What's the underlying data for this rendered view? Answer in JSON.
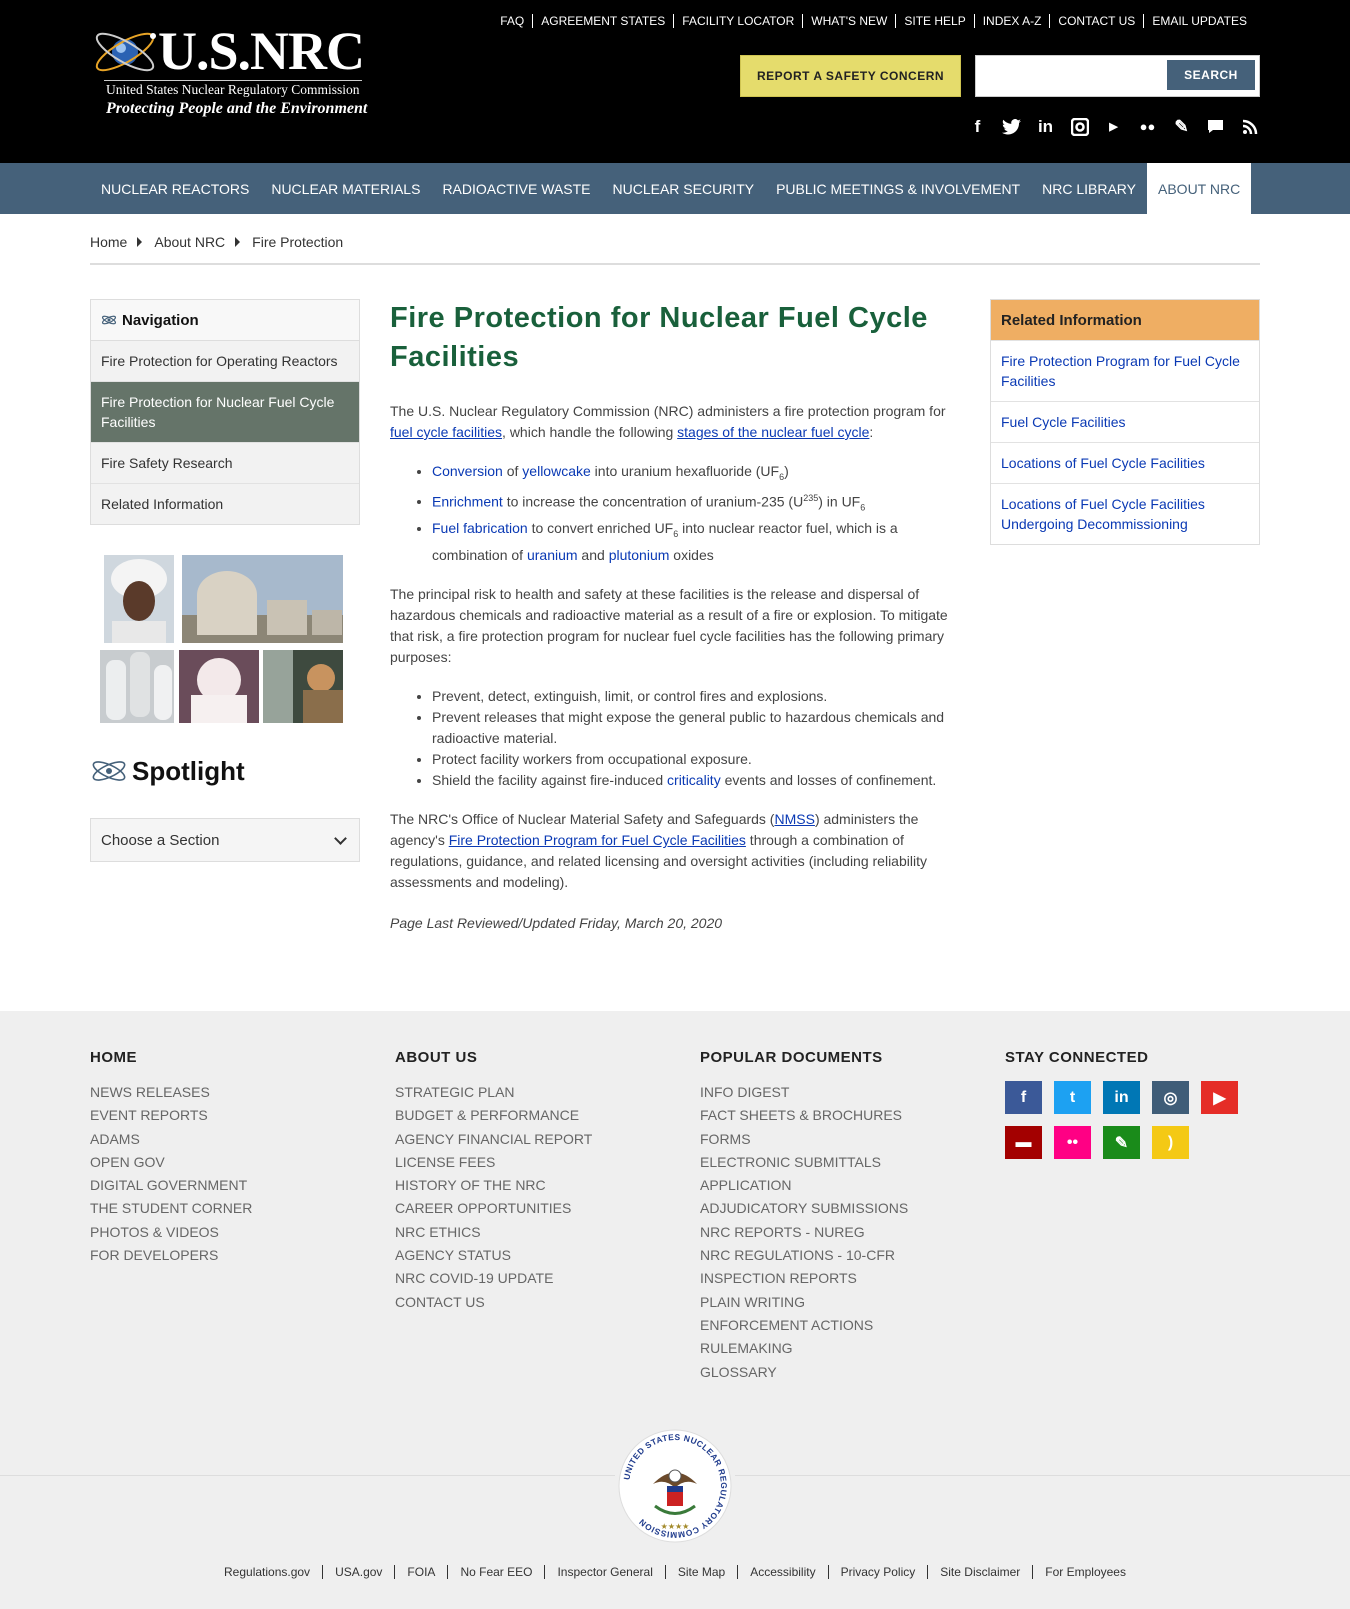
{
  "header": {
    "logo_title": "U.S.NRC",
    "logo_subtitle": "United States Nuclear Regulatory Commission",
    "logo_tagline": "Protecting People and the Environment",
    "utility_links": [
      "FAQ",
      "AGREEMENT STATES",
      "FACILITY LOCATOR",
      "WHAT'S NEW",
      "SITE HELP",
      "INDEX A-Z",
      "CONTACT US",
      "EMAIL UPDATES"
    ],
    "report_button": "REPORT A SAFETY CONCERN",
    "search_placeholder": "",
    "search_button": "SEARCH",
    "social_icons": [
      "facebook-icon",
      "twitter-icon",
      "linkedin-icon",
      "instagram-icon",
      "youtube-icon",
      "flickr-icon",
      "blog-icon",
      "comment-icon",
      "rss-icon"
    ]
  },
  "mainnav": {
    "items": [
      "NUCLEAR REACTORS",
      "NUCLEAR MATERIALS",
      "RADIOACTIVE WASTE",
      "NUCLEAR SECURITY",
      "PUBLIC MEETINGS & INVOLVEMENT",
      "NRC LIBRARY",
      "ABOUT NRC"
    ],
    "active": "ABOUT NRC"
  },
  "breadcrumb": [
    "Home",
    "About NRC",
    "Fire Protection"
  ],
  "leftnav": {
    "title": "Navigation",
    "items": [
      "Fire Protection for Operating Reactors",
      "Fire Protection for Nuclear Fuel Cycle Facilities",
      "Fire Safety Research",
      "Related Information"
    ]
  },
  "spotlight": {
    "title": "Spotlight",
    "select_value": "Choose a Section"
  },
  "content": {
    "title": "Fire Protection for Nuclear Fuel Cycle Facilities",
    "intro_1": "The U.S. Nuclear Regulatory Commission (NRC) administers a fire protection program for ",
    "link_fuel_cycle_facilities": "fuel cycle facilities",
    "intro_2": ", which handle the following ",
    "link_stages": "stages of the nuclear fuel cycle",
    "intro_3": ":",
    "b1": {
      "l1": "Conversion",
      "t1": " of ",
      "l2": "yellowcake",
      "t2": " into uranium hexafluoride (UF",
      "s1": "6",
      "t3": ")"
    },
    "b2": {
      "l1": "Enrichment",
      "t1": " to increase the concentration of uranium-235 (U",
      "sup": "235",
      "t2": ") in UF",
      "s1": "6"
    },
    "b3": {
      "l1": "Fuel fabrication",
      "t1": " to convert enriched UF",
      "s1": "6",
      "t2": " into nuclear reactor fuel, which is a combination of ",
      "l2": "uranium",
      "t3": " and ",
      "l3": "plutonium",
      "t4": " oxides"
    },
    "para2": "The principal risk to health and safety at these facilities is the release and dispersal of hazardous chemicals and radioactive material as a result of a fire or explosion. To mitigate that risk, a fire protection program for nuclear fuel cycle facilities has the following primary purposes:",
    "purposes": [
      "Prevent, detect, extinguish, limit, or control fires and explosions.",
      "Prevent releases that might expose the general public to hazardous chemicals and radioactive material.",
      "Protect facility workers from occupational exposure."
    ],
    "p4_text": "Shield the facility against fire-induced ",
    "p4_link": "criticality",
    "p4_end": " events and losses of confinement.",
    "para3_1": "The NRC's Office of Nuclear Material Safety and Safeguards (",
    "para3_link1": "NMSS",
    "para3_2": ") administers the agency's ",
    "para3_link2": "Fire Protection Program for Fuel Cycle Facilities",
    "para3_3": " through a combination of regulations, guidance, and related licensing and oversight activities (including reliability assessments and modeling).",
    "reviewed": "Page Last Reviewed/Updated Friday, March 20, 2020"
  },
  "related": {
    "title": "Related Information",
    "items": [
      "Fire Protection Program for Fuel Cycle Facilities",
      "Fuel Cycle Facilities",
      "Locations of Fuel Cycle Facilities",
      "Locations of Fuel Cycle Facilities Undergoing Decommissioning"
    ]
  },
  "footer": {
    "col1": {
      "title": "HOME",
      "links": [
        "NEWS RELEASES",
        "EVENT REPORTS",
        "ADAMS",
        "OPEN GOV",
        "DIGITAL GOVERNMENT",
        "THE STUDENT CORNER",
        "PHOTOS & VIDEOS",
        "FOR DEVELOPERS"
      ]
    },
    "col2": {
      "title": "ABOUT US",
      "links": [
        "STRATEGIC PLAN",
        "BUDGET & PERFORMANCE",
        "AGENCY FINANCIAL REPORT",
        "LICENSE FEES",
        "HISTORY OF THE NRC",
        "CAREER OPPORTUNITIES",
        "NRC ETHICS",
        "AGENCY STATUS",
        "NRC COVID-19 UPDATE",
        "CONTACT US"
      ]
    },
    "col3": {
      "title": "POPULAR DOCUMENTS",
      "links": [
        "INFO DIGEST",
        "FACT SHEETS & BROCHURES",
        "FORMS",
        "ELECTRONIC SUBMITTALS",
        "APPLICATION",
        "ADJUDICATORY SUBMISSIONS",
        "NRC REPORTS - NUREG",
        "NRC REGULATIONS - 10-CFR",
        "INSPECTION REPORTS",
        "PLAIN WRITING",
        "ENFORCEMENT ACTIONS",
        "RULEMAKING",
        "GLOSSARY"
      ]
    },
    "col4": {
      "title": "STAY CONNECTED"
    },
    "social": [
      {
        "icon": "facebook-icon",
        "glyph": "f",
        "color": "#3b5998"
      },
      {
        "icon": "twitter-icon",
        "glyph": "t",
        "color": "#1da1f2"
      },
      {
        "icon": "linkedin-icon",
        "glyph": "in",
        "color": "#0077b5"
      },
      {
        "icon": "instagram-icon",
        "glyph": "◎",
        "color": "#3f5d78"
      },
      {
        "icon": "youtube-icon",
        "glyph": "▶",
        "color": "#e52d27"
      },
      {
        "icon": "comment-icon",
        "glyph": "▬",
        "color": "#a30000"
      },
      {
        "icon": "flickr-icon",
        "glyph": "••",
        "color": "#ff0084"
      },
      {
        "icon": "blog-icon",
        "glyph": "✎",
        "color": "#1a8b1a"
      },
      {
        "icon": "rss-icon",
        "glyph": ")",
        "color": "#f4c915"
      }
    ],
    "seal_text": "UNITED STATES NUCLEAR REGULATORY COMMISSION",
    "bottom_links": [
      "Regulations.gov",
      "USA.gov",
      "FOIA",
      "No Fear EEO",
      "Inspector General",
      "Site Map",
      "Accessibility",
      "Privacy Policy",
      "Site Disclaimer",
      "For Employees"
    ]
  }
}
